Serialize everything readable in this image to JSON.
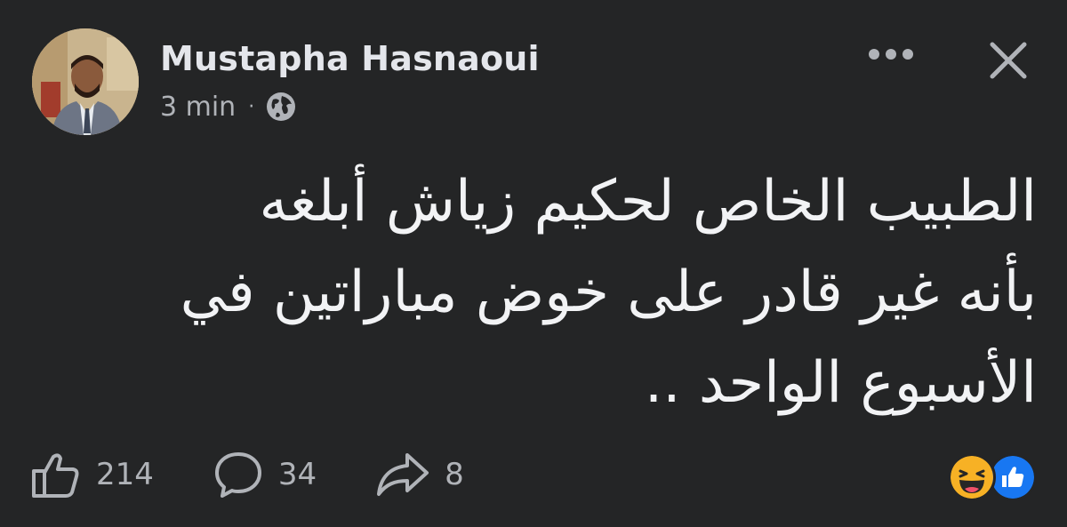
{
  "post": {
    "author": "Mustapha Hasnaoui",
    "time": "3 min",
    "separator": "·",
    "audience_icon": "globe-icon",
    "text": "الطبيب الخاص لحكيم زياش أبلغه\nبأنه غير قادر على خوض مباراتين في\nالأسبوع الواحد .."
  },
  "header": {
    "more_icon": "more-icon",
    "close_icon": "close-icon"
  },
  "actions": {
    "likes": "214",
    "comments": "34",
    "shares": "8"
  },
  "reactions": [
    "haha",
    "like"
  ],
  "colors": {
    "background": "#242526",
    "text_primary": "#e4e6eb",
    "text_secondary": "#b0b3b8",
    "like_blue": "#1877f2",
    "haha_yellow": "#f7b125"
  }
}
